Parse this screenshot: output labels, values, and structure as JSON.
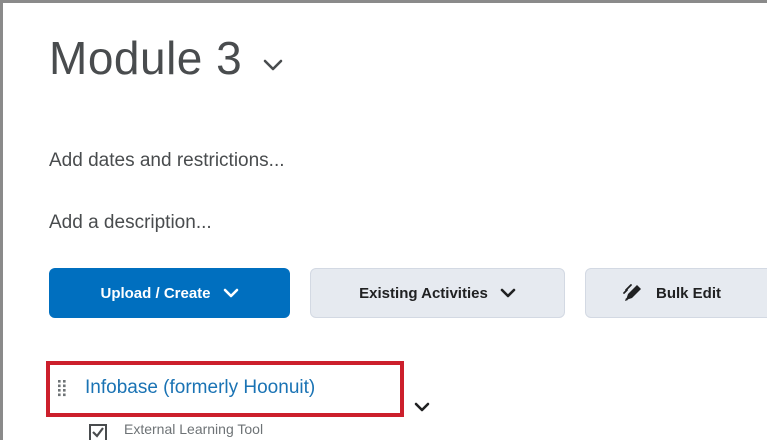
{
  "module": {
    "title": "Module 3",
    "add_dates_link": "Add dates and restrictions...",
    "add_description_link": "Add a description..."
  },
  "toolbar": {
    "upload_create_label": "Upload / Create",
    "existing_activities_label": "Existing Activities",
    "bulk_edit_label": "Bulk Edit"
  },
  "topic": {
    "title": "Infobase (formerly Hoonuit)",
    "type_label": "External Learning Tool"
  },
  "colors": {
    "primary_button": "#006fbf",
    "secondary_button": "#e6eaf0",
    "link": "#1a73b4",
    "highlight": "#cc1f2c"
  },
  "icons": {
    "title_menu": "chevron-down-icon",
    "bulk_edit": "pencil-icon",
    "drag": "drag-handle-icon",
    "topic_menu": "chevron-down-icon",
    "topic_type": "checkbox-icon"
  }
}
